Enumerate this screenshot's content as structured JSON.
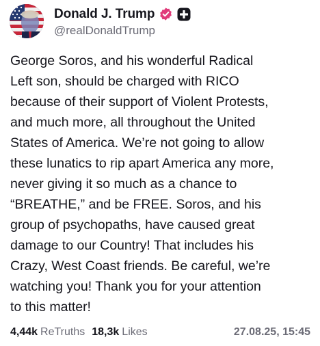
{
  "post": {
    "author": {
      "display_name": "Donald J. Trump",
      "handle": "@realDonaldTrump",
      "avatar_icon": "flag-portrait-avatar",
      "verified_icon": "verified-badge-icon",
      "badge_icon": "truth-social-badge-icon"
    },
    "text": "George Soros, and his wonderful Radical\nLeft son, should be charged with RICO\nbecause of their support of Violent Protests,\nand much more, all throughout the United\nStates of America. We’re not going to allow\nthese lunatics to rip apart America any more,\nnever giving it so much as a chance to\n“BREATHE,” and be FREE. Soros, and his\ngroup of psychopaths, have caused great\ndamage to our Country! That includes his\nCrazy, West Coast friends. Be careful, we’re\nwatching you! Thank you for your attention\nto this matter!",
    "stats": {
      "retruths_count": "4,44k",
      "retruths_label": "ReTruths",
      "likes_count": "18,3k",
      "likes_label": "Likes"
    },
    "timestamp": "27.08.25, 15:45"
  },
  "colors": {
    "text": "#16161d",
    "muted": "#6b6b76",
    "verified": "#e03a7a",
    "badge": "#16161d",
    "background": "#ffffff"
  }
}
